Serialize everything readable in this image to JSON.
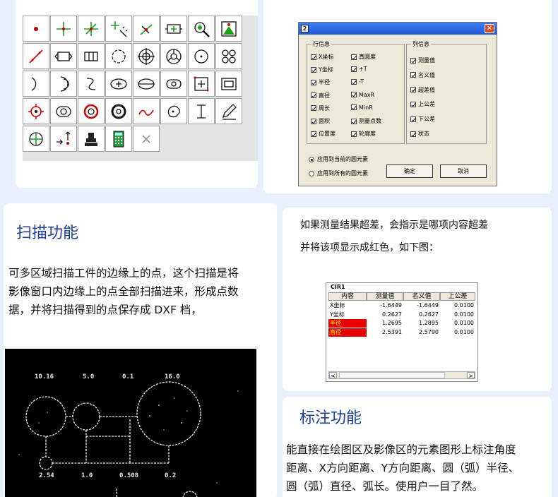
{
  "dialog": {
    "title_icon": "2",
    "close_glyph": "✕",
    "row_group": {
      "label": "行信息",
      "left_items": [
        "X坐标",
        "Y坐标",
        "半径",
        "直径",
        "周长",
        "面积",
        "位置度"
      ],
      "right_items": [
        "真圆度",
        "+T",
        "-T",
        "MaxR",
        "MinR",
        "测量点数",
        "轮廓度"
      ]
    },
    "col_group": {
      "label": "列信息",
      "items": [
        "测量值",
        "名义值",
        "超差值",
        "上公差",
        "下公差",
        "状态"
      ]
    },
    "radio_current": "应用到当前的圆元素",
    "radio_all": "应用到所有的圆元素",
    "ok_label": "确定",
    "cancel_label": "取消"
  },
  "scan": {
    "heading": "扫描功能",
    "lines": [
      "可多区域扫描工件的边缘上的点，这个扫描是将",
      "影像窗口内边缘上的点全部扫描进来，形成点数",
      "据，并将扫描得到的点保存成 DXF 档，"
    ],
    "image_labels": [
      "10.16",
      "5.0",
      "0.1",
      "16.0",
      "2.54",
      "1.0",
      "0.508",
      "0.2"
    ]
  },
  "result": {
    "lines": [
      "如果测量结果超差，会指示是哪项内容超差",
      "并将该项显示成红色，如下图："
    ],
    "table": {
      "title": "CIR1",
      "headers": [
        "内容",
        "测量值",
        "名义值",
        "上公差"
      ],
      "rows": [
        {
          "name": "X坐标",
          "measured": "-1.6449",
          "nominal": "-1.6449",
          "upper": "0.0100",
          "over": false
        },
        {
          "name": "Y坐标",
          "measured": "0.2627",
          "nominal": "0.2627",
          "upper": "0.0100",
          "over": false
        },
        {
          "name": "半径",
          "measured": "1.2695",
          "nominal": "1.2895",
          "upper": "0.0100",
          "over": true
        },
        {
          "name": "直径",
          "measured": "2.5391",
          "nominal": "2.5790",
          "upper": "0.0100",
          "over": true
        }
      ],
      "scroll_left": "<",
      "scroll_right": ">"
    }
  },
  "annot": {
    "heading": "标注功能",
    "lines": [
      "能直接在绘图区及影像区的元素图形上标注角度",
      "距离、X方向距离、Y方向距离、圆（弧）半径、",
      "圆（弧）直径、弧长。使用户一目了然。"
    ]
  },
  "colors": {
    "accent": "#1b3f9b",
    "over_bg": "#e60000",
    "over_text": "#ffff00",
    "background": "#e9f0fb"
  },
  "toolbar_icons": [
    "point-icon",
    "cross-point-icon",
    "star-point-icon",
    "cross-wand-icon",
    "edge-point-icon",
    "box-measure-icon",
    "magnify-icon",
    "peak-icon",
    "line-icon",
    "line-box-icon",
    "double-line-box-icon",
    "circle-icon",
    "target-circle-icon",
    "three-arc-icon",
    "center-circle-icon",
    "four-circles-icon",
    "arc-icon",
    "double-arc-icon",
    "s-curve-icon",
    "ellipse-icon",
    "ellipse-cross-icon",
    "slot-icon",
    "rect-cross-icon",
    "rect-slot-icon",
    "gear-circle-icon",
    "ring-box-icon",
    "red-ring-icon",
    "ring-icon",
    "curve-icon",
    "blob-icon",
    "t-shape-icon",
    "pencil-icon",
    "circle-target-icon",
    "arrow-point-icon",
    "probe-icon",
    "calculator-icon",
    "delete-icon"
  ]
}
